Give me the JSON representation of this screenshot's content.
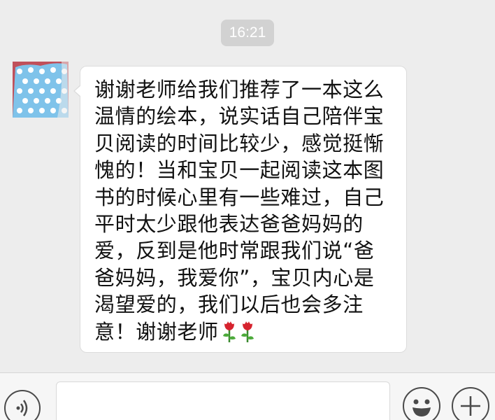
{
  "chat": {
    "timestamp": "16:21",
    "message": {
      "text": "谢谢老师给我们推荐了一本这么\n温情的绘本，说实话自己陪伴宝\n贝阅读的时间比较少，感觉挺惭\n愧的！当和宝贝一起阅读这本图\n书的时候心里有一些难过，自己\n平时太少跟他表达爸爸妈妈的\n爱，反到是他时常跟我们说“爸\n爸妈妈，我爱你”，宝贝内心是\n渴望爱的，我们以后也会多注\n意！谢谢老师",
      "emoji": [
        "rose-icon",
        "rose-icon"
      ]
    },
    "avatar": {
      "icon": "polka-dot-avatar",
      "colors": [
        "#7fc3ea",
        "#ffffff",
        "#c0505a"
      ]
    }
  },
  "input_bar": {
    "voice_icon": "voice-icon",
    "text_value": "",
    "emoji_icon": "smiley-icon",
    "plus_icon": "plus-icon"
  },
  "colors": {
    "background": "#ededed",
    "bubble": "#ffffff",
    "timestamp_bg": "#d2d2d2"
  }
}
